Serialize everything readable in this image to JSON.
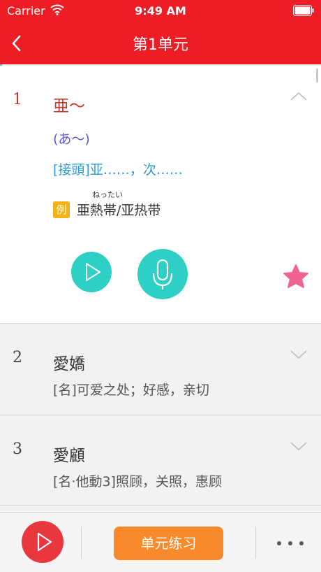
{
  "status_bar": {
    "carrier": "Carrier",
    "time": "9:49 AM"
  },
  "nav": {
    "title": "第1单元"
  },
  "entries": [
    {
      "number": "1",
      "word": "亜～",
      "reading": "(あ～)",
      "meaning": "[接頭]亚……，次……",
      "example": {
        "badge": "例",
        "ruby": "ねったい",
        "text": "亜熱帯/亚热带"
      }
    },
    {
      "number": "2",
      "word": "愛嬌",
      "meaning": "[名]可爱之处；好感，亲切"
    },
    {
      "number": "3",
      "word": "愛顧",
      "meaning": "[名·他動3]照顾，关照，惠顾"
    }
  ],
  "bottom_bar": {
    "practice_label": "单元练习"
  },
  "colors": {
    "header": "#ee1c25",
    "accent_teal": "#2ecfc4",
    "star": "#f06292",
    "practice": "#f98a2c",
    "play_red": "#e8383d",
    "badge": "#f5b21a"
  }
}
